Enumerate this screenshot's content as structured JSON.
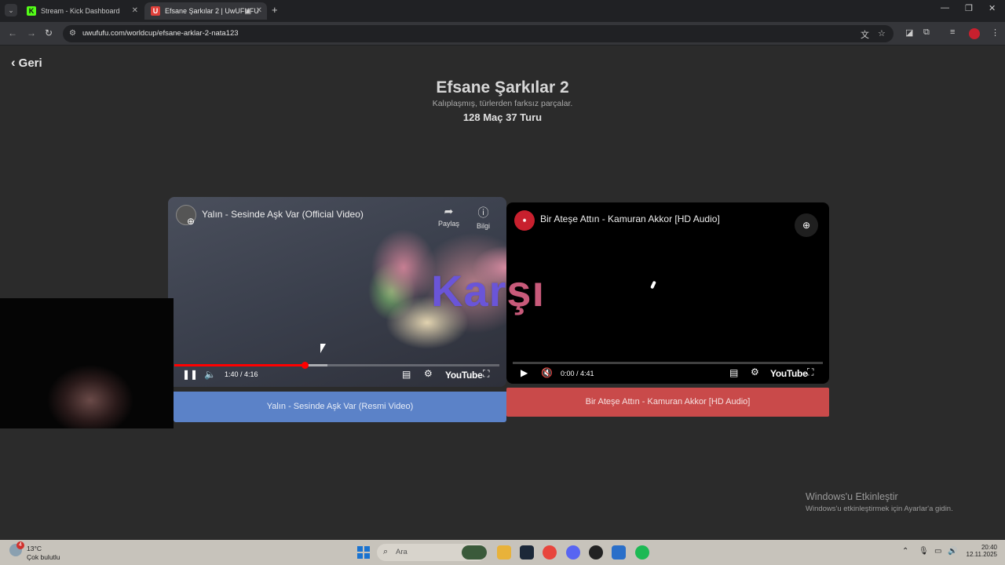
{
  "browser": {
    "tabs": [
      {
        "title": "Stream - Kick Dashboard",
        "favicon": "K"
      },
      {
        "title": "Efsane Şarkılar 2 | UwUFUFU",
        "favicon": "U"
      }
    ],
    "url": "uwufufu.com/worldcup/efsane-arklar-2-nata123"
  },
  "page": {
    "back_label": "Geri",
    "title": "Efsane Şarkılar 2",
    "subtitle": "Kalıplaşmış, türlerden farksız parçalar.",
    "round_info": "128 Maç 37 Turu",
    "vs_label_a": "Kar",
    "vs_label_b": "şı"
  },
  "left_video": {
    "title": "Yalın - Sesinde Aşk Var (Official Video)",
    "share_label": "Paylaş",
    "info_label": "Bilgi",
    "time": "1:40 / 4:16",
    "progress": 0.4,
    "buffered": 0.47,
    "youtube_label": "YouTube",
    "choice_label": "Yalın - Sesinde Aşk Var (Resmi Video)"
  },
  "right_video": {
    "title": "Bir Ateşe Attın - Kamuran Akkor [HD Audio]",
    "time": "0:00 / 4:41",
    "progress": 0,
    "youtube_label": "YouTube",
    "choice_label": "Bir Ateşe Attın - Kamuran Akkor [HD Audio]"
  },
  "watermark": {
    "line1": "Windows'u Etkinleştir",
    "line2": "Windows'u etkinleştirmek için Ayarlar'a gidin."
  },
  "taskbar": {
    "weather_badge": "4",
    "temperature": "13°C",
    "condition": "Çok bulutlu",
    "search_placeholder": "Ara",
    "time": "20:40",
    "date": "12.11.2025"
  },
  "colors": {
    "left_choice": "#5b82c8",
    "right_choice": "#c94a4a",
    "progress": "#ff0000"
  }
}
